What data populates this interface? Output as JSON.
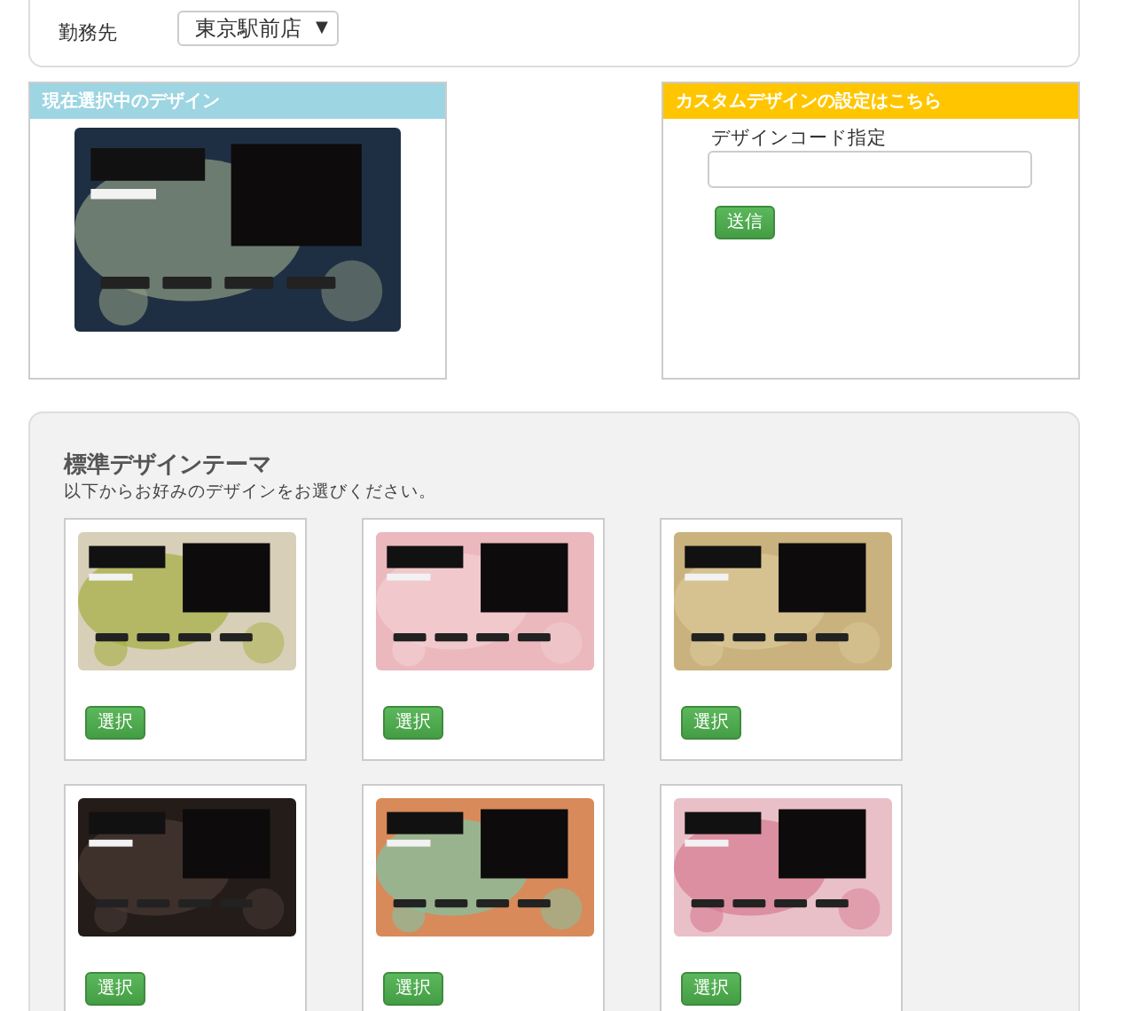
{
  "workplace": {
    "label": "勤務先",
    "value": "東京駅前店",
    "caret": "▼"
  },
  "current_design": {
    "title": "現在選択中のデザイン"
  },
  "custom_design": {
    "title": "カスタムデザインの設定はこちら",
    "field_label": "デザインコード指定",
    "submit": "送信"
  },
  "standard_themes": {
    "title": "標準デザインテーマ",
    "subtitle": "以下からお好みのデザインをお選びください。",
    "themes": [
      {
        "button": "選択"
      },
      {
        "button": "選択"
      },
      {
        "button": "選択"
      },
      {
        "button": "選択"
      },
      {
        "button": "選択"
      },
      {
        "button": "選択"
      }
    ]
  }
}
